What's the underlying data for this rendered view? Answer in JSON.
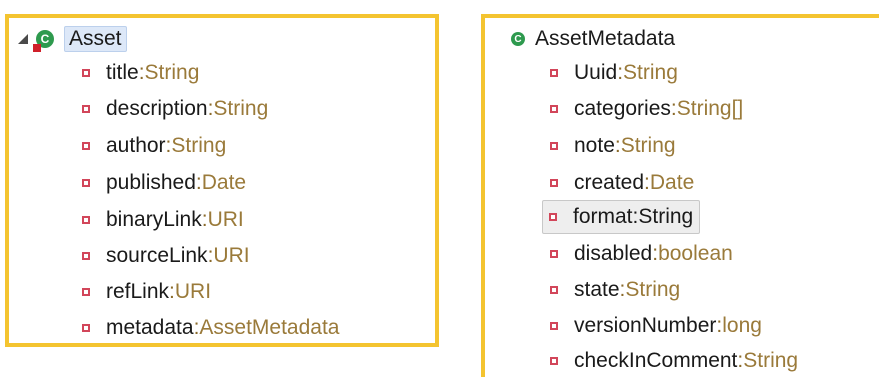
{
  "left_class": {
    "name": "Asset",
    "icon": "class-error-icon",
    "fields": [
      {
        "name": "title",
        "type": "String"
      },
      {
        "name": "description",
        "type": "String"
      },
      {
        "name": "author",
        "type": "String"
      },
      {
        "name": "published",
        "type": "Date"
      },
      {
        "name": "binaryLink",
        "type": "URI"
      },
      {
        "name": "sourceLink",
        "type": "URI"
      },
      {
        "name": "refLink",
        "type": "URI"
      },
      {
        "name": "metadata",
        "type": "AssetMetadata"
      }
    ]
  },
  "right_class": {
    "name": "AssetMetadata",
    "icon": "class-icon",
    "fields": [
      {
        "name": "Uuid",
        "type": "String"
      },
      {
        "name": "categories",
        "type": "String[]"
      },
      {
        "name": "note",
        "type": "String"
      },
      {
        "name": "created",
        "type": "Date"
      },
      {
        "name": "format",
        "type": "String"
      },
      {
        "name": "disabled",
        "type": "boolean"
      },
      {
        "name": "state",
        "type": "String"
      },
      {
        "name": "versionNumber",
        "type": "long"
      },
      {
        "name": "checkInComment",
        "type": "String"
      }
    ]
  },
  "separator": " : ",
  "colors": {
    "border": "#f4c430",
    "field_bullet": "#d2465a",
    "type_text": "#9a7a3a",
    "class_icon": "#2e9a4e"
  }
}
